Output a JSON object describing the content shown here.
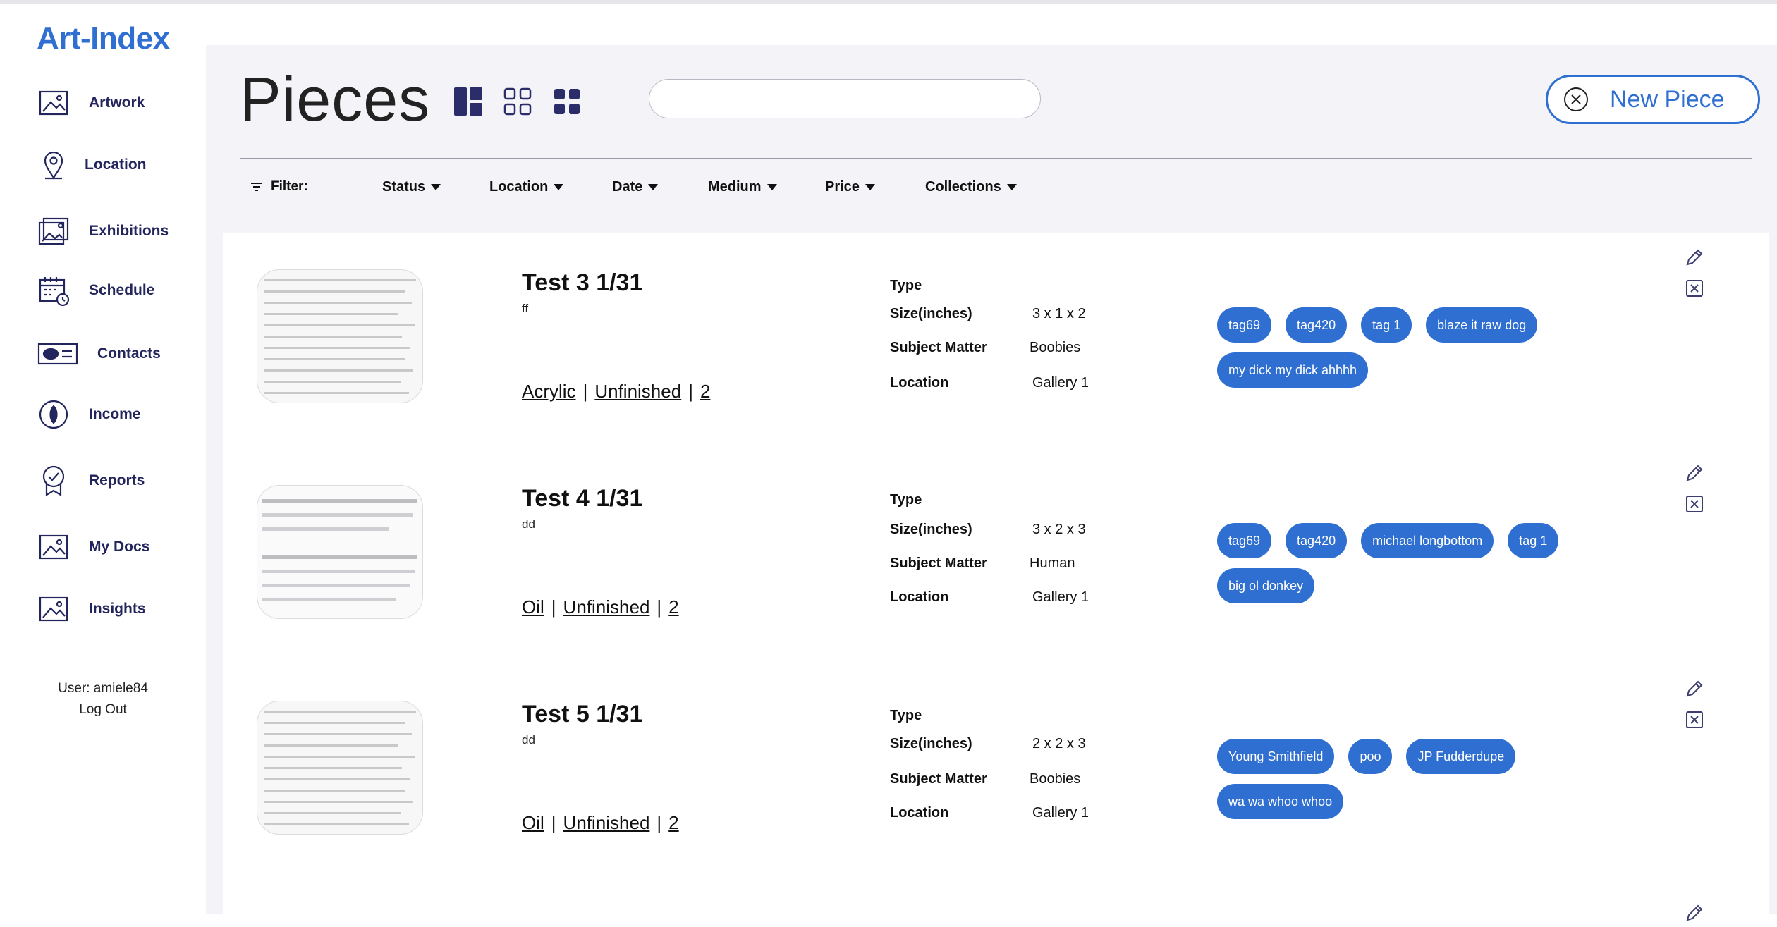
{
  "app": {
    "logo": "Art-Index"
  },
  "sidebar": {
    "items": [
      {
        "label": "Artwork",
        "icon": "image-icon"
      },
      {
        "label": "Location",
        "icon": "location-pin-icon"
      },
      {
        "label": "Exhibitions",
        "icon": "images-icon"
      },
      {
        "label": "Schedule",
        "icon": "calendar-clock-icon"
      },
      {
        "label": "Contacts",
        "icon": "contact-card-icon"
      },
      {
        "label": "Income",
        "icon": "coin-icon"
      },
      {
        "label": "Reports",
        "icon": "award-ribbon-icon"
      },
      {
        "label": "My Docs",
        "icon": "image-icon"
      },
      {
        "label": "Insights",
        "icon": "image-icon"
      }
    ],
    "user": "User: amiele84",
    "logout": "Log Out"
  },
  "header": {
    "title": "Pieces",
    "search_placeholder": "",
    "new_piece_label": "New Piece"
  },
  "filters": {
    "label": "Filter:",
    "options": [
      "Status",
      "Location",
      "Date",
      "Medium",
      "Price",
      "Collections"
    ]
  },
  "pieces": [
    {
      "name": "Test 3 1/31",
      "subtitle": "ff",
      "medium": "Acrylic",
      "status": "Unfinished",
      "count": "2",
      "type_label": "Type",
      "type": "",
      "size_label": "Size(inches)",
      "size": "3 x 1 x 2",
      "subject_label": "Subject Matter",
      "subject": "Boobies",
      "location_label": "Location",
      "location": "Gallery 1",
      "tags": [
        "tag69",
        "tag420",
        "tag 1",
        "blaze it raw dog",
        "my dick my dick ahhhh"
      ]
    },
    {
      "name": "Test 4 1/31",
      "subtitle": "dd",
      "medium": "Oil",
      "status": "Unfinished",
      "count": "2",
      "type_label": "Type",
      "type": "",
      "size_label": "Size(inches)",
      "size": "3 x 2 x 3",
      "subject_label": "Subject Matter",
      "subject": "Human",
      "location_label": "Location",
      "location": "Gallery 1",
      "tags": [
        "tag69",
        "tag420",
        "michael longbottom",
        "tag 1",
        "big ol donkey"
      ]
    },
    {
      "name": "Test 5 1/31",
      "subtitle": "dd",
      "medium": "Oil",
      "status": "Unfinished",
      "count": "2",
      "type_label": "Type",
      "type": "",
      "size_label": "Size(inches)",
      "size": "2 x 2 x 3",
      "subject_label": "Subject Matter",
      "subject": "Boobies",
      "location_label": "Location",
      "location": "Gallery 1",
      "tags": [
        "Young Smithfield",
        "poo",
        "JP Fudderdupe",
        "wa wa whoo whoo"
      ]
    }
  ],
  "colors": {
    "accent": "#2f6fd1",
    "nav": "#23265c",
    "main_bg": "#f4f4f8"
  }
}
